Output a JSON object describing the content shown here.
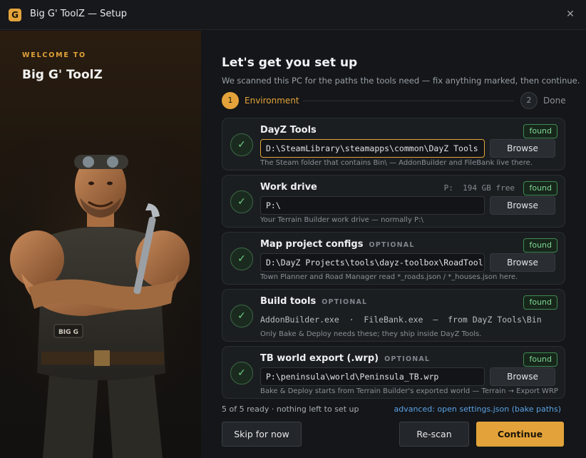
{
  "window": {
    "icon_letter": "G",
    "title": "Big G' ToolZ — Setup",
    "close_glyph": "✕"
  },
  "left": {
    "kicker": "WELCOME TO",
    "title": "Big G' ToolZ",
    "mascot_shirt_text": "BIG G"
  },
  "main": {
    "heading": "Let's get you set up",
    "subheading": "We scanned this PC for the paths the tools need — fix anything marked, then continue.",
    "steps": [
      {
        "number": "1",
        "label": "Environment",
        "state": "active"
      },
      {
        "number": "2",
        "label": "Done",
        "state": "pending"
      }
    ],
    "cards": [
      {
        "title": "DayZ Tools",
        "optional": "",
        "badge": "found",
        "extra": "",
        "value": "D:\\SteamLibrary\\steamapps\\common\\DayZ Tools",
        "button": "Browse",
        "hint": "The Steam folder that contains Bin\\ — AddonBuilder and FileBank live there."
      },
      {
        "title": "Work drive",
        "optional": "",
        "badge": "found",
        "extra": "P:  194 GB free",
        "value": "P:\\",
        "button": "Browse",
        "hint": "Your Terrain Builder work drive — normally P:\\"
      },
      {
        "title": "Map project configs",
        "optional": "OPTIONAL",
        "badge": "found",
        "extra": "",
        "value": "D:\\DayZ Projects\\tools\\dayz-toolbox\\RoadTool",
        "button": "Browse",
        "hint": "Town Planner and Road Manager read *_roads.json / *_houses.json here."
      },
      {
        "title": "Build tools",
        "optional": "OPTIONAL",
        "badge": "found",
        "extra": "",
        "value": "AddonBuilder.exe  ·  FileBank.exe  —  from DayZ Tools\\Bin",
        "button": "",
        "hint": "Only Bake & Deploy needs these; they ship inside DayZ Tools."
      },
      {
        "title": "TB world export (.wrp)",
        "optional": "OPTIONAL",
        "badge": "found",
        "extra": "",
        "value": "P:\\peninsula\\world\\Peninsula_TB.wrp",
        "button": "Browse",
        "hint": "Bake & Deploy starts from Terrain Builder's exported world — Terrain → Export WRP"
      }
    ],
    "status": "5 of 5 ready · nothing left to set up",
    "advanced_link": "advanced: open settings.json (bake paths)",
    "buttons": {
      "skip": "Skip for now",
      "rescan": "Re-scan",
      "continue": "Continue"
    },
    "check_glyph": "✓"
  },
  "colors": {
    "accent": "#e3a33a",
    "success": "#7fd792",
    "link": "#5aa2e6",
    "background": "#141619"
  }
}
